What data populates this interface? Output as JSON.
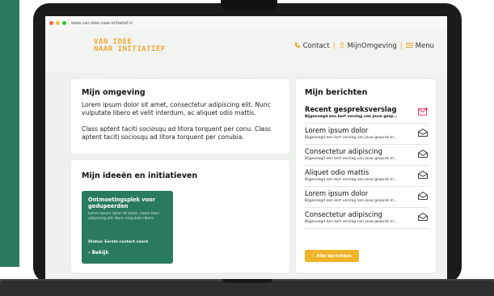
{
  "browser": {
    "url": "www.van-idee-naar-initiatief.nl"
  },
  "site": {
    "logo_line1": "VAN IDEE",
    "logo_line2": "NAAR INITIATIEF",
    "nav": {
      "contact": "Contact",
      "mijnomgeving": "MijnOmgeving",
      "menu": "Menu"
    }
  },
  "omgeving": {
    "title": "Mijn omgeving",
    "p1": "Lorem ipsum dolor sit amet, consectetur adipiscing elit. Nunc vulputate libero et velit interdum, ac aliquet odio mattis.",
    "p2": "Class aptent taciti sociosqu ad litora torquent per conu. Class aptent taciti sociosqu ad litora torquent per conubia."
  },
  "ideeen": {
    "title": "Mijn ideeën en initiatieven",
    "card": {
      "title": "Ontmoetingsplek voor gedupeerden",
      "text": "Lorem ipsum dolor sit amet, conse tetur adipiscing elit. Nunc vulputate libero.",
      "status": "Status: Eerste contact coach",
      "link": "Bekijk"
    }
  },
  "berichten": {
    "title": "Mijn berichten",
    "items": [
      {
        "title": "Recent gespreksverslag",
        "sub": "Bijgevoegd een kort verslag van jouw gesp...",
        "unread": true
      },
      {
        "title": "Lorem ipsum dolor",
        "sub": "Bijgevoegd een kort verslag van jouw gesprek m...",
        "unread": false
      },
      {
        "title": "Consectetur adipiscing",
        "sub": "Bijgevoegd een kort verslag van jouw gesprek m...",
        "unread": false
      },
      {
        "title": "Aliquet odio mattis",
        "sub": "Bijgevoegd een kort verslag van jouw gesprek m...",
        "unread": false
      },
      {
        "title": "Lorem ipsum dolor",
        "sub": "Bijgevoegd een kort verslag van jouw gesprek m...",
        "unread": false
      },
      {
        "title": "Consectetur adipiscing",
        "sub": "Bijgevoegd een kort verslag van jouw gesprek m...",
        "unread": false
      }
    ],
    "all_button": "Alle berichten"
  },
  "colors": {
    "brand_green": "#2a7a5e",
    "accent_orange": "#f0a830",
    "button_yellow": "#f0b429",
    "unread_pink": "#e0245e"
  }
}
